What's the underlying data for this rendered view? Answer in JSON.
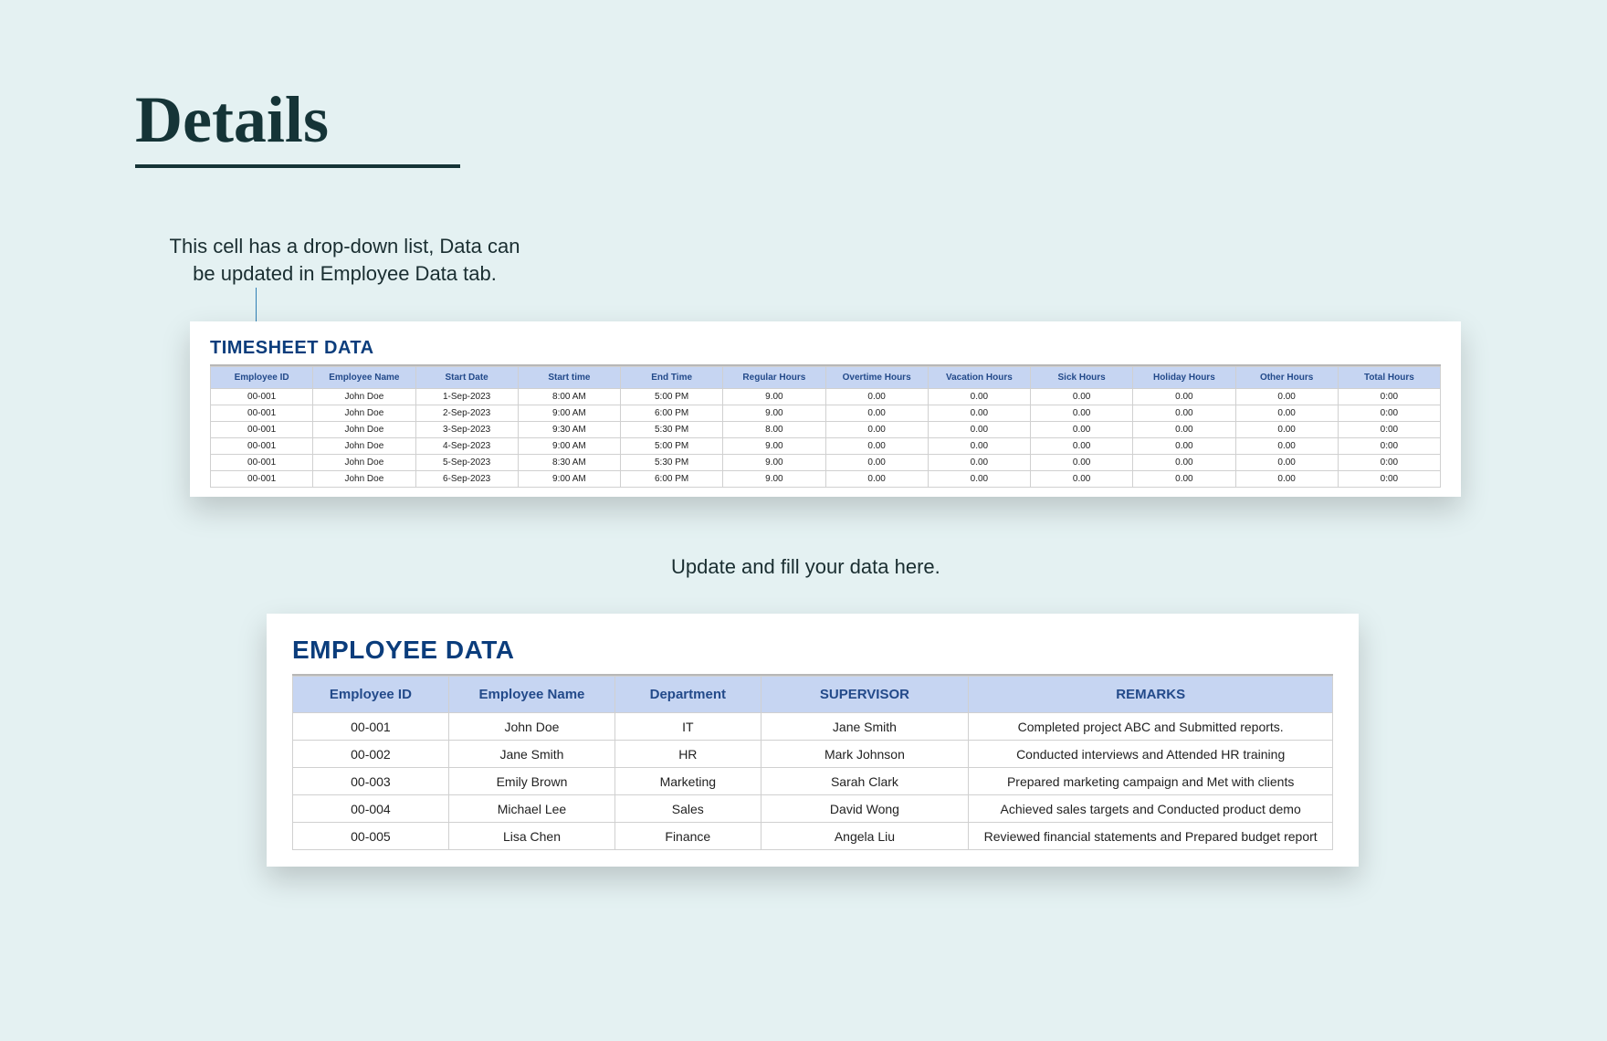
{
  "page": {
    "title": "Details",
    "caption_dropdown": "This cell has a drop-down list, Data can be updated in Employee Data tab.",
    "caption_update": "Update and fill your data here."
  },
  "timesheet": {
    "title": "TIMESHEET DATA",
    "headers": [
      "Employee ID",
      "Employee Name",
      "Start Date",
      "Start time",
      "End Time",
      "Regular Hours",
      "Overtime Hours",
      "Vacation Hours",
      "Sick Hours",
      "Holiday Hours",
      "Other Hours",
      "Total Hours"
    ],
    "rows": [
      [
        "00-001",
        "John Doe",
        "1-Sep-2023",
        "8:00 AM",
        "5:00 PM",
        "9.00",
        "0.00",
        "0.00",
        "0.00",
        "0.00",
        "0.00",
        "0:00"
      ],
      [
        "00-001",
        "John Doe",
        "2-Sep-2023",
        "9:00 AM",
        "6:00 PM",
        "9.00",
        "0.00",
        "0.00",
        "0.00",
        "0.00",
        "0.00",
        "0:00"
      ],
      [
        "00-001",
        "John Doe",
        "3-Sep-2023",
        "9:30 AM",
        "5:30 PM",
        "8.00",
        "0.00",
        "0.00",
        "0.00",
        "0.00",
        "0.00",
        "0:00"
      ],
      [
        "00-001",
        "John Doe",
        "4-Sep-2023",
        "9:00 AM",
        "5:00 PM",
        "9.00",
        "0.00",
        "0.00",
        "0.00",
        "0.00",
        "0.00",
        "0:00"
      ],
      [
        "00-001",
        "John Doe",
        "5-Sep-2023",
        "8:30 AM",
        "5:30 PM",
        "9.00",
        "0.00",
        "0.00",
        "0.00",
        "0.00",
        "0.00",
        "0:00"
      ],
      [
        "00-001",
        "John Doe",
        "6-Sep-2023",
        "9:00 AM",
        "6:00 PM",
        "9.00",
        "0.00",
        "0.00",
        "0.00",
        "0.00",
        "0.00",
        "0:00"
      ]
    ]
  },
  "employee": {
    "title": "EMPLOYEE DATA",
    "headers": [
      "Employee ID",
      "Employee Name",
      "Department",
      "SUPERVISOR",
      "REMARKS"
    ],
    "col_widths": [
      "15%",
      "16%",
      "14%",
      "20%",
      "35%"
    ],
    "rows": [
      [
        "00-001",
        "John Doe",
        "IT",
        "Jane Smith",
        "Completed project ABC and Submitted reports."
      ],
      [
        "00-002",
        "Jane Smith",
        "HR",
        "Mark Johnson",
        "Conducted interviews and Attended HR training"
      ],
      [
        "00-003",
        "Emily Brown",
        "Marketing",
        "Sarah Clark",
        "Prepared marketing campaign and Met with clients"
      ],
      [
        "00-004",
        "Michael Lee",
        "Sales",
        "David Wong",
        "Achieved sales targets and Conducted product demo"
      ],
      [
        "00-005",
        "Lisa Chen",
        "Finance",
        "Angela Liu",
        "Reviewed financial statements and Prepared budget report"
      ]
    ]
  }
}
